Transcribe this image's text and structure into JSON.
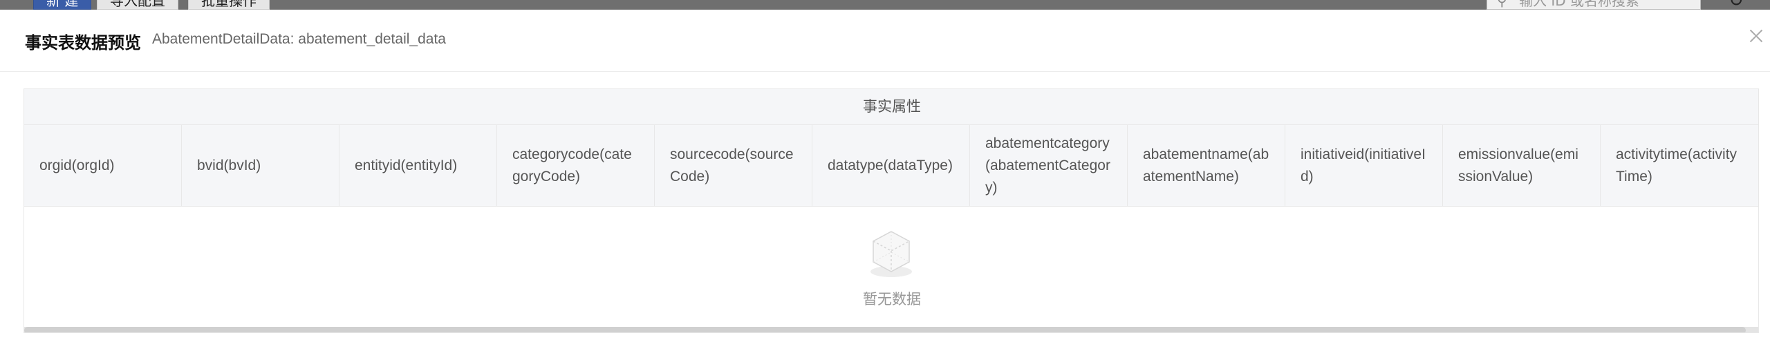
{
  "background_toolbar": {
    "new_label": "新 建",
    "import_label": "导入配置",
    "batch_label": "批量操作",
    "search_placeholder": "输入 ID 或名称搜索"
  },
  "modal": {
    "title": "事实表数据预览",
    "subtitle": "AbatementDetailData: abatement_detail_data",
    "close_icon": "close-icon"
  },
  "table": {
    "group_header": "事实属性",
    "columns": [
      "orgid(orgId)",
      "bvid(bvId)",
      "entityid(entityId)",
      "categorycode(categoryCode)",
      "sourcecode(sourceCode)",
      "datatype(dataType)",
      "abatementcategory(abatementCategory)",
      "abatementname(abatementName)",
      "initiativeid(initiativeId)",
      "emissionvalue(emissionValue)",
      "activitytime(activityTime)"
    ],
    "rows": [],
    "empty_text": "暂无数据"
  },
  "colors": {
    "header_bg": "#f5f6f8",
    "border": "#e8e8e8",
    "primary": "#3a5da8"
  }
}
